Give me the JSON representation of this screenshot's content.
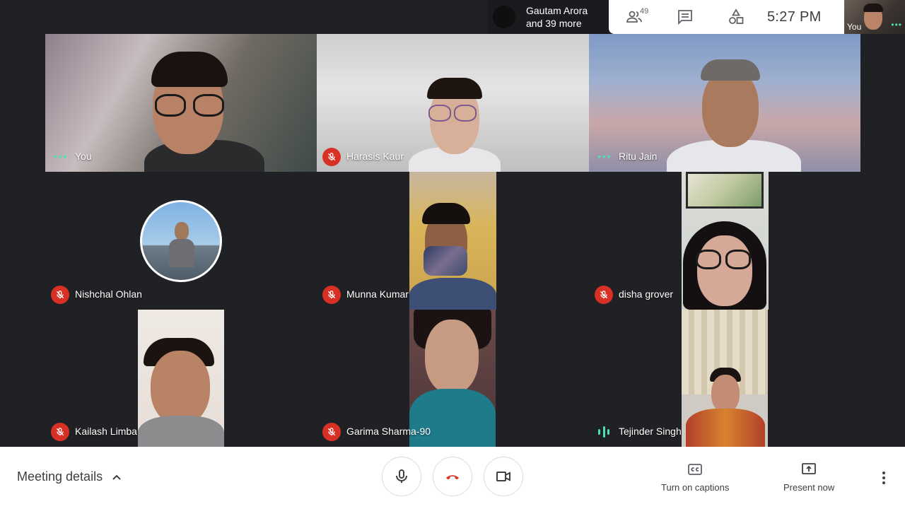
{
  "top_bar": {
    "speaker_name": "Gautam Arora",
    "speaker_more": "and 39 more",
    "participants_count": "49",
    "time": "5:27  PM",
    "self_label": "You"
  },
  "tiles": [
    {
      "name": "You",
      "status": "speaking-dots"
    },
    {
      "name": "Harasis Kaur",
      "status": "muted"
    },
    {
      "name": "Ritu Jain",
      "status": "speaking-dots"
    },
    {
      "name": "Nishchal Ohlan",
      "status": "muted"
    },
    {
      "name": "Munna Kumar",
      "status": "muted"
    },
    {
      "name": "disha grover",
      "status": "muted"
    },
    {
      "name": "Kailash Limba",
      "status": "muted"
    },
    {
      "name": "Garima Sharma-90",
      "status": "muted"
    },
    {
      "name": "Tejinder Singh",
      "status": "audio-active"
    }
  ],
  "bottom_bar": {
    "meeting_details": "Meeting details",
    "captions_label": "Turn on captions",
    "present_label": "Present now"
  },
  "colors": {
    "background": "#202124",
    "mute_red": "#d93025",
    "active_teal": "#4ee0b4",
    "end_call_red": "#d93025"
  }
}
